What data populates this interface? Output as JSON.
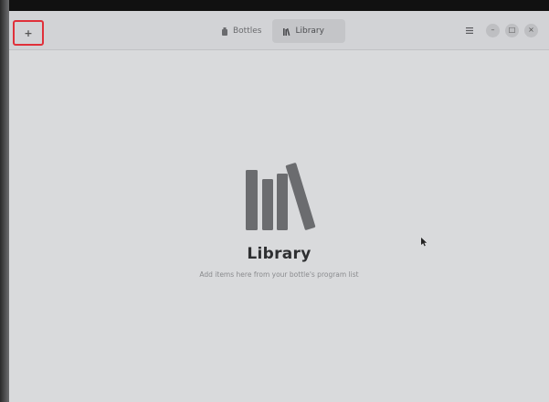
{
  "headerbar": {
    "add_button_label": "+",
    "tabs": [
      {
        "label": "Bottles",
        "icon": "bottle-icon",
        "active": false
      },
      {
        "label": "Library",
        "icon": "library-icon",
        "active": true
      }
    ],
    "menu_icon": "hamburger-menu-icon",
    "controls": {
      "minimize": "–",
      "maximize": "□",
      "close": "×"
    }
  },
  "library": {
    "title": "Library",
    "description": "Add items here from your bottle's program list"
  },
  "colors": {
    "highlight_border": "#e0303a",
    "icon_gray": "#6b6c6f",
    "title_text": "#2e2f31"
  }
}
